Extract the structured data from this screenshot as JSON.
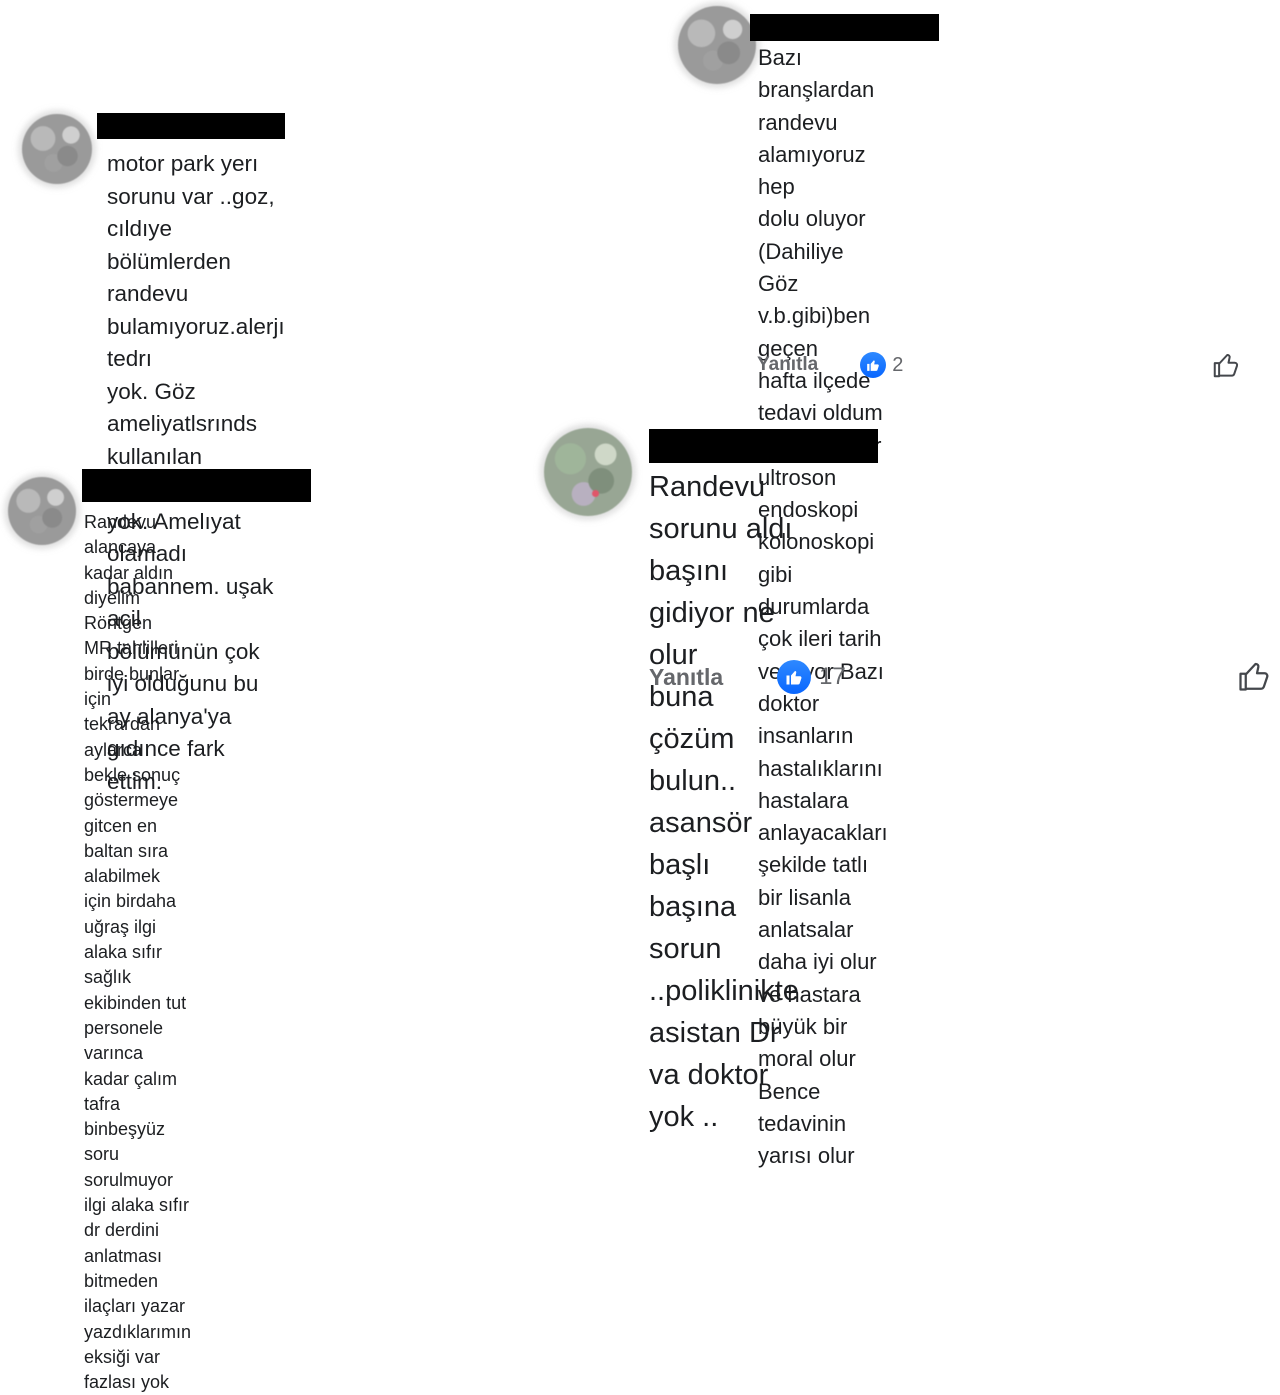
{
  "comments": [
    {
      "id": "top-left",
      "text": "motor park yerı sorunu var ..goz, cıldıye\nbölümlerden randevu bulamıyoruz.alerjı tedrı\nyok. Göz ameliyatlsrınds kullanılan tansiyon aletı\nyok. Amelıyat olamadı babannem. uşak acil\nbölümünün çok iyi olduğunu bu ay alanya'ya\ngıdınce fark ettim."
    },
    {
      "id": "top-right",
      "text": "Bazı branşlardan randevu alamıyoruz hep\ndolu oluyor (Dahiliye Göz v.b.gibi)ben geçen\nhafta ilçede tedavi oldum geldim.Emar\nultroson endoskopi kolonoskopi gibi\ndurumlarda çok ileri tarih veriliyor Bazı\ndoktor insanların hastalıklarını hastalara\nanlayacakları şekilde tatlı bir lisanla\nanlatsalar daha iyi olur ve hastara büyük bir\nmoral olur Bence tedavinin yarısı olur",
      "reply_label": "Yanıtla",
      "like_count": "2"
    },
    {
      "id": "bottom-left",
      "text": "Randevu alancaya kadar aldın diyelim Röntgen\nMR tahlilleri birde bunlar için tekrardan aylarca\nbekle sonuç göstermeye gitcen en baltan sıra\nalabilmek için birdaha uğraş ilgi alaka sıfır sağlık\nekibinden tut personele varınca kadar çalım\ntafra binbeşyüz soru sorulmuyor ilgi alaka sıfır\ndr derdini anlatması bitmeden ilaçları yazar\nyazdıklarımın eksiği var fazlası yok"
    },
    {
      "id": "bottom-right",
      "text": "Randevu sorunu aldı başını gidiyor ne olur\nbuna çözüm bulun.. asansör başlı başına\nsorun ..poliklinikte asistan Dr va doktor\nyok ..",
      "reply_label": "Yanıtla",
      "like_count": "17"
    }
  ],
  "colors": {
    "like_blue": "#0866ff",
    "muted_text": "#65676b",
    "redaction": "#000000"
  },
  "icons": [
    "like-reaction-icon",
    "thumbs-up-icon"
  ]
}
